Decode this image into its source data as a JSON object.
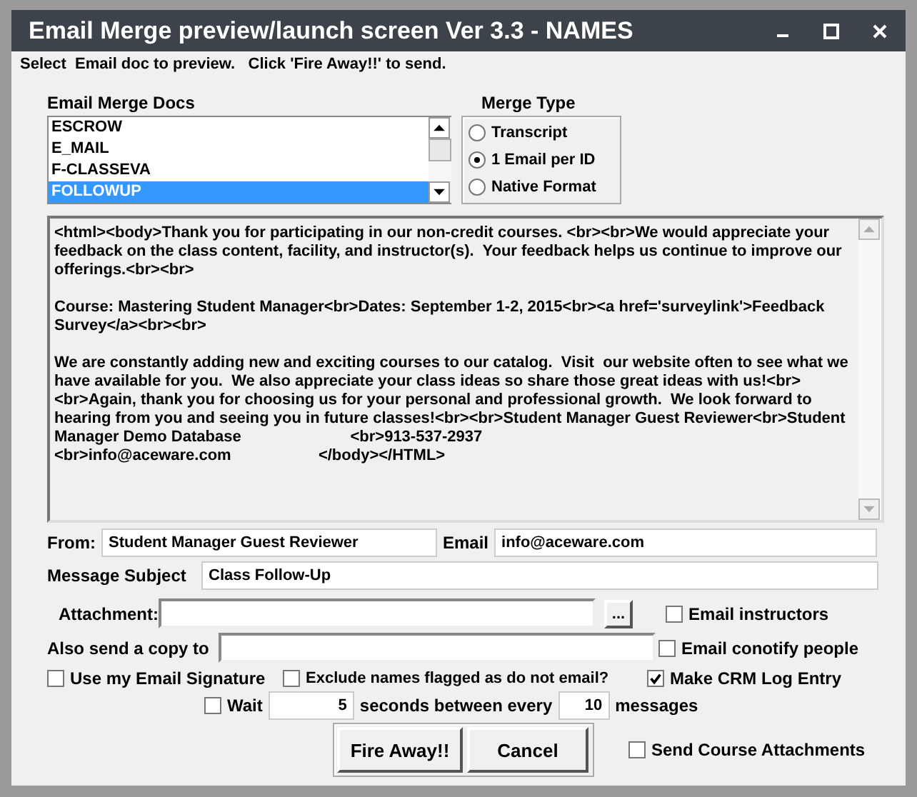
{
  "window": {
    "title": "Email Merge preview/launch screen Ver 3.3 - NAMES"
  },
  "instruction": "Select  Email doc to preview.   Click 'Fire Away!!' to send.",
  "docs": {
    "label": "Email Merge Docs",
    "items": [
      {
        "label": "ESCROW",
        "selected": false
      },
      {
        "label": "E_MAIL",
        "selected": false
      },
      {
        "label": "F-CLASSEVA",
        "selected": false
      },
      {
        "label": "FOLLOWUP",
        "selected": true
      }
    ]
  },
  "merge_type": {
    "label": "Merge Type",
    "options": [
      {
        "label": "Transcript",
        "selected": false
      },
      {
        "label": "1 Email per ID",
        "selected": true
      },
      {
        "label": "Native Format",
        "selected": false
      }
    ]
  },
  "preview": {
    "paragraphs": [
      "<html><body>Thank you for participating in our non-credit courses. <br><br>We would appreciate your feedback on the class content, facility, and instructor(s).  Your feedback helps us continue to improve our offerings.<br><br>",
      "Course: Mastering Student Manager<br>Dates: September 1-2, 2015<br><a href='surveylink'>Feedback Survey</a><br><br>",
      "We are constantly adding new and exciting courses to our catalog.  Visit  our website often to see what we have available for you.  We also appreciate your class ideas so share those great ideas with us!<br><br>Again, thank you for choosing us for your personal and professional growth.  We look forward to hearing from you and seeing you in future classes!<br><br>Student Manager Guest Reviewer<br>Student Manager Demo Database                         <br>913-537-2937\n<br>info@aceware.com                    </body></HTML>"
    ]
  },
  "from": {
    "label": "From:",
    "value": "Student Manager Guest Reviewer"
  },
  "email": {
    "label": "Email",
    "value": "info@aceware.com"
  },
  "subject": {
    "label": "Message Subject",
    "value": "Class Follow-Up"
  },
  "attachment": {
    "label": "Attachment:",
    "browse": "..."
  },
  "copy_to": {
    "label": "Also send a copy to"
  },
  "email_instructors": {
    "label": "Email instructors",
    "checked": false
  },
  "email_conotify": {
    "label": "Email conotify people",
    "checked": false
  },
  "use_signature": {
    "label": "Use my Email Signature",
    "checked": false
  },
  "exclude_flagged": {
    "label": "Exclude names flagged as do not email?",
    "checked": false
  },
  "crm_log": {
    "label": "Make CRM Log Entry",
    "checked": true
  },
  "wait": {
    "label": "Wait",
    "checked": false,
    "seconds": "5",
    "between": "seconds between every",
    "count": "10",
    "unit": "messages"
  },
  "buttons": [
    "Fire Away!!",
    "Cancel"
  ],
  "send_course_attachments": {
    "label": "Send Course Attachments",
    "checked": false
  }
}
